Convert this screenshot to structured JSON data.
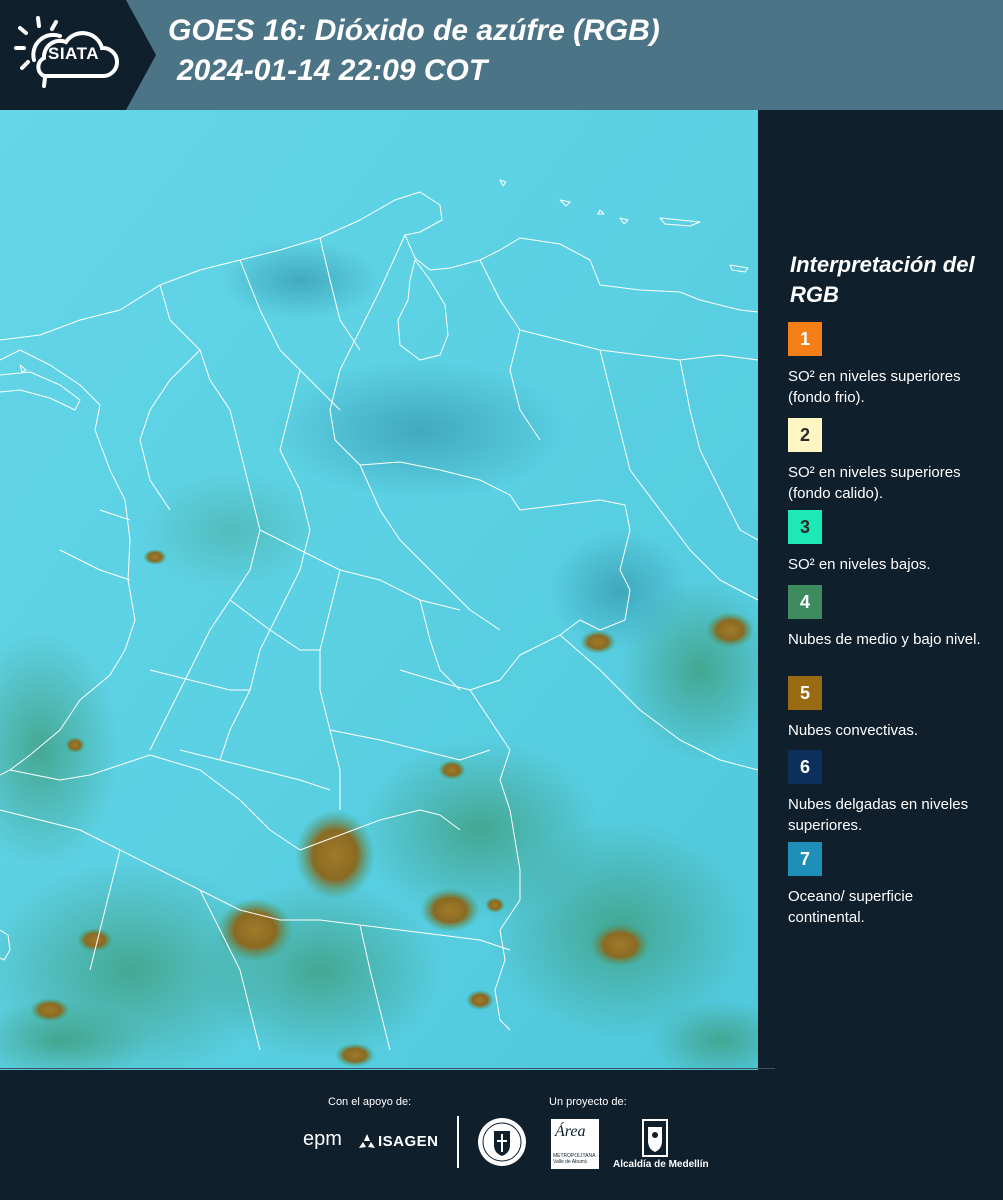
{
  "header": {
    "logo_text": "SIATA",
    "title_line1": "GOES 16: Dióxido de azúfre (RGB)",
    "title_line2": "2024-01-14 22:09 COT"
  },
  "legend": {
    "title": "Interpretación del RGB",
    "items": [
      {
        "number": "1",
        "color": "#f57f17",
        "number_color": "#ffffff",
        "description": "SO² en niveles superiores (fondo frio)."
      },
      {
        "number": "2",
        "color": "#fff6c4",
        "number_color": "#2b2b2b",
        "description": "SO² en niveles superiores (fondo calido)."
      },
      {
        "number": "3",
        "color": "#1de9b6",
        "number_color": "#2b2b2b",
        "description": "SO² en niveles bajos."
      },
      {
        "number": "4",
        "color": "#3d8b5f",
        "number_color": "#ffffff",
        "description": "Nubes de medio y bajo nivel."
      },
      {
        "number": "5",
        "color": "#9a6a13",
        "number_color": "#ffffff",
        "description": "Nubes convectivas."
      },
      {
        "number": "6",
        "color": "#0c2f5c",
        "number_color": "#ffffff",
        "description": "Nubes delgadas en niveles superiores."
      },
      {
        "number": "7",
        "color": "#1e8fb8",
        "number_color": "#ffffff",
        "description": "Oceano/ superficie continental."
      }
    ]
  },
  "footer": {
    "support_label": "Con el apoyo de:",
    "project_label": "Un proyecto de:",
    "sponsors": {
      "epm": "epm",
      "isagen": "ISAGEN",
      "area_logo": "Área",
      "area_sub": "METROPOLITANA Valle de Aburrá",
      "alcaldia": "Alcaldía de Medellín"
    }
  },
  "colors": {
    "background": "#0f1f2c",
    "header_bar": "#4c7487",
    "sky_base": "#5dd3e6"
  }
}
